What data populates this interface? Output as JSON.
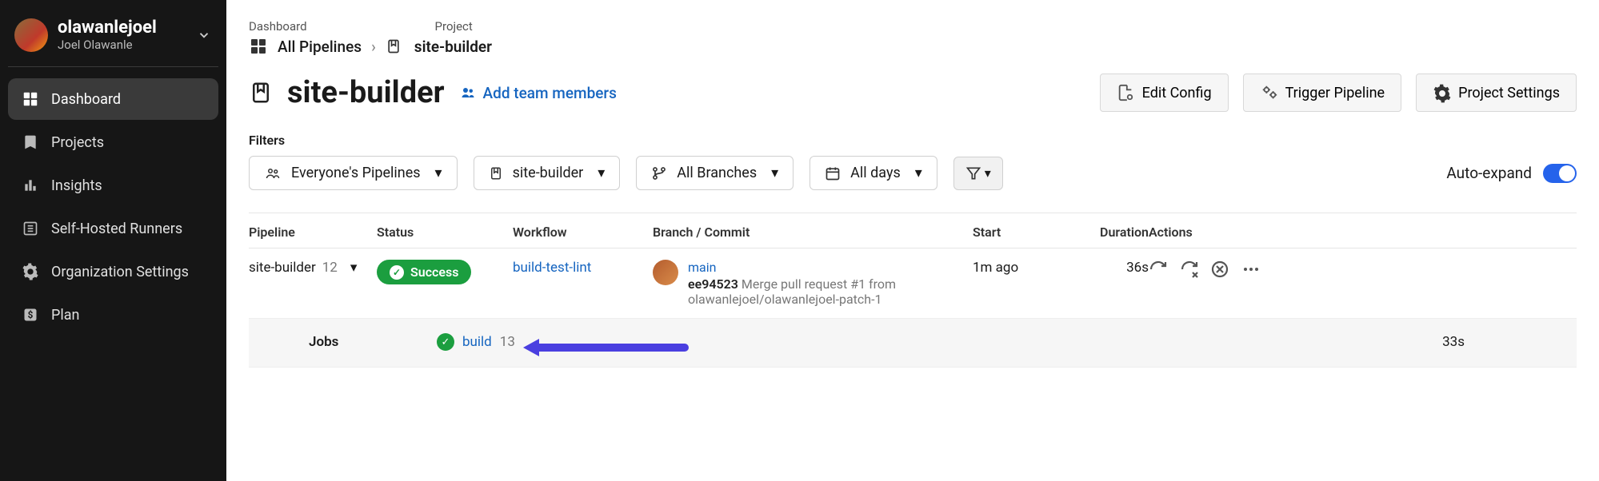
{
  "org": {
    "handle": "olawanlejoel",
    "name": "Joel Olawanle"
  },
  "nav": {
    "dashboard": "Dashboard",
    "projects": "Projects",
    "insights": "Insights",
    "runners": "Self-Hosted Runners",
    "org_settings": "Organization Settings",
    "plan": "Plan"
  },
  "crumbs": {
    "top_dashboard": "Dashboard",
    "top_project": "Project",
    "all_pipelines": "All Pipelines",
    "project": "site-builder"
  },
  "title": "site-builder",
  "add_members": "Add team members",
  "buttons": {
    "edit_config": "Edit Config",
    "trigger": "Trigger Pipeline",
    "settings": "Project Settings"
  },
  "filters_label": "Filters",
  "filters": {
    "whose": "Everyone's Pipelines",
    "project": "site-builder",
    "branch": "All Branches",
    "days": "All days"
  },
  "auto_expand": "Auto-expand",
  "columns": {
    "pipeline": "Pipeline",
    "status": "Status",
    "workflow": "Workflow",
    "branch": "Branch / Commit",
    "start": "Start",
    "duration": "Duration",
    "actions": "Actions"
  },
  "row": {
    "pipeline_name": "site-builder",
    "pipeline_num": "12",
    "status": "Success",
    "workflow": "build-test-lint",
    "branch": "main",
    "commit_hash": "ee94523",
    "commit_msg": "Merge pull request #1 from olawanlejoel/olawanlejoel-patch-1",
    "start": "1m ago",
    "duration": "36s"
  },
  "jobs": {
    "label": "Jobs",
    "name": "build",
    "num": "13",
    "duration": "33s"
  }
}
